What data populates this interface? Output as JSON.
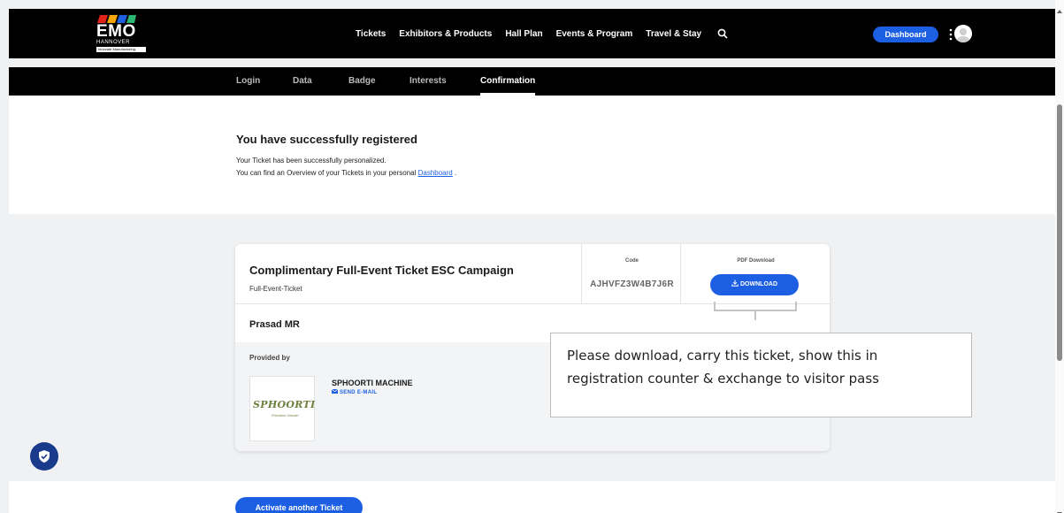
{
  "brand": {
    "logo_text": "EMO",
    "logo_sub": "HANNOVER",
    "logo_tag": "Innovate Manufacturing.",
    "stripe_colors": [
      "#e2231a",
      "#f7a600",
      "#1d5fe3",
      "#2bb673"
    ]
  },
  "nav": {
    "items": [
      "Tickets",
      "Exhibitors & Products",
      "Hall Plan",
      "Events & Program",
      "Travel & Stay"
    ],
    "dashboard_label": "Dashboard"
  },
  "steps": {
    "items": [
      "Login",
      "Data",
      "Badge",
      "Interests",
      "Confirmation"
    ],
    "active": "Confirmation"
  },
  "confirmation": {
    "title": "You have successfully registered",
    "line1": "Your Ticket has been successfully personalized.",
    "line2_prefix": "You can find an Overview of your Tickets in your personal ",
    "line2_link": "Dashboard",
    "line2_suffix": " ."
  },
  "ticket": {
    "title": "Complimentary Full-Event Ticket ESC Campaign",
    "type": "Full-Event-Ticket",
    "code_label": "Code",
    "code": "AJHVFZ3W4B7J6R",
    "pdf_label": "PDF Download",
    "download_label": "DOWNLOAD",
    "holder": "Prasad MR",
    "provided_label": "Provided by",
    "provider_name": "SPHOORTI MACHINE",
    "provider_logo_text": "SPHOORTI",
    "provider_logo_sub": "Precision Growth",
    "send_email_label": "SEND E-MAIL"
  },
  "callout": {
    "text": "Please download, carry this ticket, show this in registration counter & exchange to visitor pass"
  },
  "actions": {
    "activate_label": "Activate another Ticket"
  },
  "colors": {
    "accent": "#1d5fe3",
    "nav_bg": "#000000",
    "page_bg": "#f0f1f3"
  }
}
